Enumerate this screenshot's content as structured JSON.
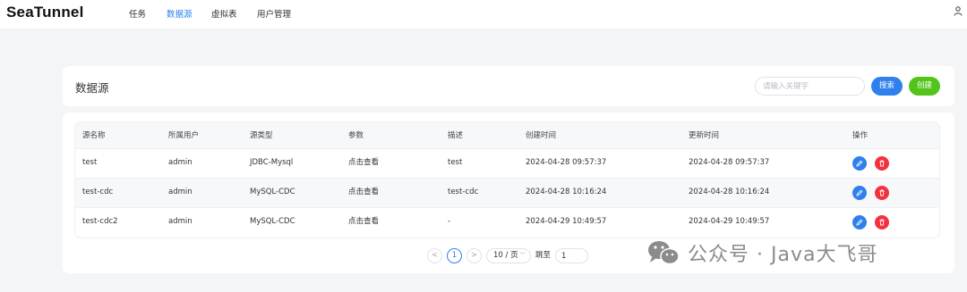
{
  "app": {
    "brand": "SeaTunnel"
  },
  "nav": [
    {
      "label": "任务",
      "active": false
    },
    {
      "label": "数据源",
      "active": true
    },
    {
      "label": "虚拟表",
      "active": false
    },
    {
      "label": "用户管理",
      "active": false
    }
  ],
  "header": {
    "title": "数据源",
    "search_placeholder": "请输入关键字",
    "search_label": "搜索",
    "create_label": "创建"
  },
  "table": {
    "columns": [
      "源名称",
      "所属用户",
      "源类型",
      "参数",
      "描述",
      "创建时间",
      "更新时间",
      "操作"
    ],
    "rows": [
      {
        "name": "test",
        "user": "admin",
        "type": "JDBC-Mysql",
        "params": "点击查看",
        "desc": "test",
        "created": "2024-04-28 09:57:37",
        "updated": "2024-04-28 09:57:37"
      },
      {
        "name": "test-cdc",
        "user": "admin",
        "type": "MySQL-CDC",
        "params": "点击查看",
        "desc": "test-cdc",
        "created": "2024-04-28 10:16:24",
        "updated": "2024-04-28 10:16:24"
      },
      {
        "name": "test-cdc2",
        "user": "admin",
        "type": "MySQL-CDC",
        "params": "点击查看",
        "desc": "-",
        "created": "2024-04-29 10:49:57",
        "updated": "2024-04-29 10:49:57"
      }
    ]
  },
  "pagination": {
    "prev": "<",
    "current": "1",
    "next": ">",
    "page_size": "10 / 页",
    "jump_label": "跳至",
    "jump_value": "1"
  },
  "watermark": {
    "text": "公众号 · Java大飞哥"
  },
  "colors": {
    "primary": "#2f80ed",
    "success": "#52c41a",
    "danger": "#f5313d"
  }
}
